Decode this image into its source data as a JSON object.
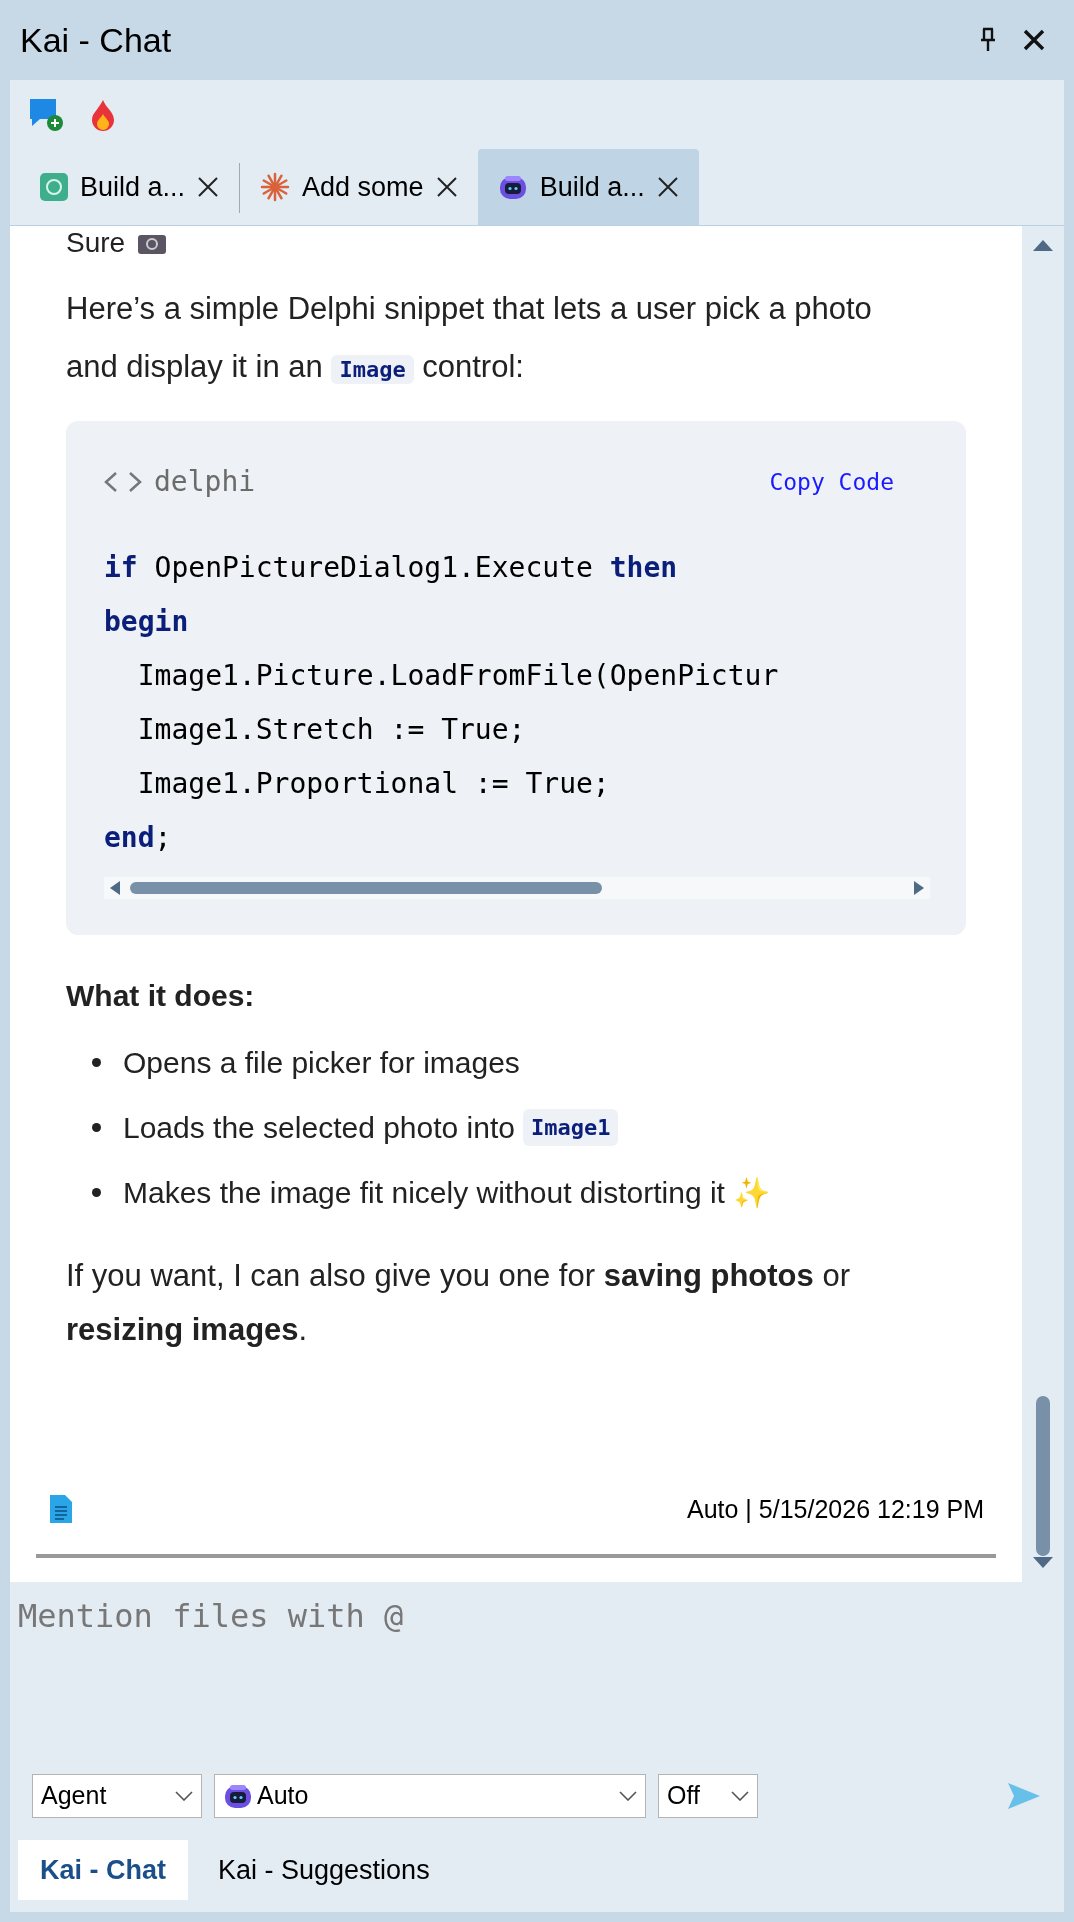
{
  "window": {
    "title": "Kai - Chat"
  },
  "chat_tabs": [
    {
      "label": "Build a...",
      "selected": false
    },
    {
      "label": "Add some",
      "selected": false
    },
    {
      "label": "Build a...",
      "selected": true
    }
  ],
  "message": {
    "greeting": "Sure",
    "intro": [
      "Here’s a simple Delphi snippet that lets a user pick a photo and display it in an ",
      "Image",
      " control:"
    ],
    "code": {
      "language": "delphi",
      "copy_label": "Copy Code",
      "lines": [
        [
          {
            "kind": "keyword",
            "text": "if"
          },
          {
            "kind": "plain",
            "text": " OpenPictureDialog1.Execute "
          },
          {
            "kind": "keyword",
            "text": "then"
          }
        ],
        [
          {
            "kind": "keyword",
            "text": "begin"
          }
        ],
        [
          {
            "kind": "plain",
            "text": "  Image1.Picture.LoadFromFile(OpenPictur"
          }
        ],
        [
          {
            "kind": "plain",
            "text": "  Image1.Stretch := True;"
          }
        ],
        [
          {
            "kind": "plain",
            "text": "  Image1.Proportional := True;"
          }
        ],
        [
          {
            "kind": "keyword",
            "text": "end"
          },
          {
            "kind": "plain",
            "text": ";"
          }
        ]
      ]
    },
    "heading": "What it does:",
    "bullets": [
      {
        "parts": [
          "Opens a file picker for images"
        ]
      },
      {
        "parts": [
          "Loads the selected photo into ",
          "Image1"
        ]
      },
      {
        "parts": [
          "Makes the image fit nicely without distorting it ✨"
        ]
      }
    ],
    "closing": "If you want, I can also give you one for **saving photos** or **resizing images**.",
    "meta": "Auto | 5/15/2026 12:19 PM"
  },
  "input": {
    "placeholder": "Mention files with @"
  },
  "selectors": [
    {
      "value": "Agent"
    },
    {
      "value": "Auto"
    },
    {
      "value": "Off"
    }
  ],
  "bottom_tabs": [
    {
      "label": "Kai - Chat",
      "selected": true
    },
    {
      "label": "Kai - Suggestions",
      "selected": false
    }
  ]
}
